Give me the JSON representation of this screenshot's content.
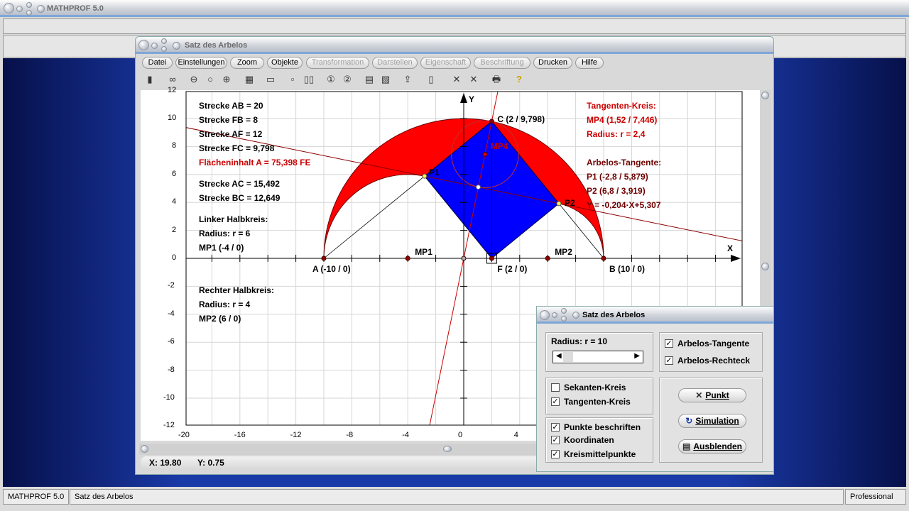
{
  "app": {
    "title": "MATHPROF 5.0"
  },
  "window": {
    "title": "Satz des Arbelos"
  },
  "menu": [
    {
      "label": "Datei",
      "enabled": true
    },
    {
      "label": "Einstellungen",
      "enabled": true
    },
    {
      "label": "Zoom",
      "enabled": true
    },
    {
      "label": "Objekte",
      "enabled": true
    },
    {
      "label": "Transformation",
      "enabled": false
    },
    {
      "label": "Darstellen",
      "enabled": false
    },
    {
      "label": "Eigenschaft",
      "enabled": false
    },
    {
      "label": "Beschriftung",
      "enabled": false
    },
    {
      "label": "Drucken",
      "enabled": true
    },
    {
      "label": "Hilfe",
      "enabled": true
    }
  ],
  "toolbar": [
    "window-icon",
    "glasses-icon",
    "zoom-out-icon",
    "zoom-reset-icon",
    "zoom-in-icon",
    "properties-icon",
    "layout-icon",
    "single-frame-icon",
    "double-frame-icon",
    "number-1-icon",
    "number-2-icon",
    "table-icon",
    "document-icon",
    "export-icon",
    "copy-icon",
    "cross-points-icon",
    "cross-points-double-icon",
    "print-icon",
    "help-icon"
  ],
  "left_info": [
    "Strecke AB = 20",
    "Strecke FB = 8",
    "Strecke AF = 12",
    "Strecke FC = 9,798",
    "Flächeninhalt A = 75,398 FE",
    "Strecke AC = 15,492",
    "Strecke BC = 12,649",
    "Linker Halbkreis:",
    "Radius: r = 6",
    "MP1 (-4 / 0)",
    "Rechter Halbkreis:",
    "Radius: r = 4",
    "MP2 (6 / 0)"
  ],
  "right_info": {
    "tangent_circle": [
      "Tangenten-Kreis:",
      "MP4 (1,52 / 7,446)",
      "Radius: r = 2,4"
    ],
    "arbelos_tangent": [
      "Arbelos-Tangente:",
      "P1 (-2,8 / 5,879)",
      "P2 (6,8 / 3,919)",
      "Y = -0,204·X+5,307"
    ]
  },
  "plot": {
    "x_range": [
      -20,
      20
    ],
    "y_range": [
      -12,
      12
    ],
    "grid_step": 2,
    "x_ticks": [
      "-20",
      "-16",
      "-12",
      "-8",
      "-4",
      "0",
      "4"
    ],
    "y_ticks": [
      "12",
      "10",
      "8",
      "6",
      "4",
      "2",
      "0",
      "-2",
      "-4",
      "-6",
      "-8",
      "-10",
      "-12"
    ],
    "axis_x_label": "X",
    "axis_y_label": "Y",
    "colors": {
      "arbelos": "#ff0000",
      "rectangle": "#0000ff",
      "tangent_line": "#8b0000",
      "normal_line": "#cc0000",
      "text_red": "#cc0000",
      "text_darkred": "#700000"
    },
    "big_circle": {
      "cx": 0,
      "cy": 0,
      "r": 10
    },
    "left_circle": {
      "cx": -4,
      "cy": 0,
      "r": 6
    },
    "right_circle": {
      "cx": 6,
      "cy": 0,
      "r": 4
    },
    "tangent_circle": {
      "cx": 1.52,
      "cy": 7.446,
      "r": 2.4
    },
    "tangent_line": {
      "m": -0.204,
      "b": 5.307
    },
    "normal_line": {
      "m": 4.9,
      "b": 0
    },
    "points": [
      {
        "name": "A",
        "label": "A (-10 / 0)",
        "x": -10,
        "y": 0
      },
      {
        "name": "MP1",
        "label": "MP1",
        "x": -4,
        "y": 0
      },
      {
        "name": "O",
        "label": "",
        "x": 0,
        "y": 0
      },
      {
        "name": "F",
        "label": "F (2 / 0)",
        "x": 2,
        "y": 0
      },
      {
        "name": "MP2",
        "label": "MP2",
        "x": 6,
        "y": 0
      },
      {
        "name": "B",
        "label": "B (10 / 0)",
        "x": 10,
        "y": 0
      },
      {
        "name": "C",
        "label": "C (2 / 9,798)",
        "x": 2,
        "y": 9.798
      },
      {
        "name": "P1",
        "label": "P1",
        "x": -2.8,
        "y": 5.879
      },
      {
        "name": "P2",
        "label": "P2",
        "x": 6.8,
        "y": 3.919
      },
      {
        "name": "MP4",
        "label": "MP4",
        "x": 1.52,
        "y": 7.446
      }
    ]
  },
  "coords": {
    "x": "X: 19.80",
    "y": "Y: 0.75"
  },
  "dialog": {
    "title": "Satz des Arbelos",
    "radius_label": "Radius:  r = 10",
    "radius_value": 10,
    "checks": [
      {
        "label": "Arbelos-Tangente",
        "checked": true
      },
      {
        "label": "Arbelos-Rechteck",
        "checked": true
      },
      {
        "label": "Sekanten-Kreis",
        "checked": false
      },
      {
        "label": "Tangenten-Kreis",
        "checked": true
      },
      {
        "label": "Punkte beschriften",
        "checked": true
      },
      {
        "label": "Koordinaten",
        "checked": true
      },
      {
        "label": "Kreismittelpunkte",
        "checked": true
      }
    ],
    "buttons": [
      "Punkt",
      "Simulation",
      "Ausblenden"
    ]
  },
  "statusbar": [
    "MATHPROF 5.0",
    "Satz des Arbelos",
    "Professional"
  ]
}
